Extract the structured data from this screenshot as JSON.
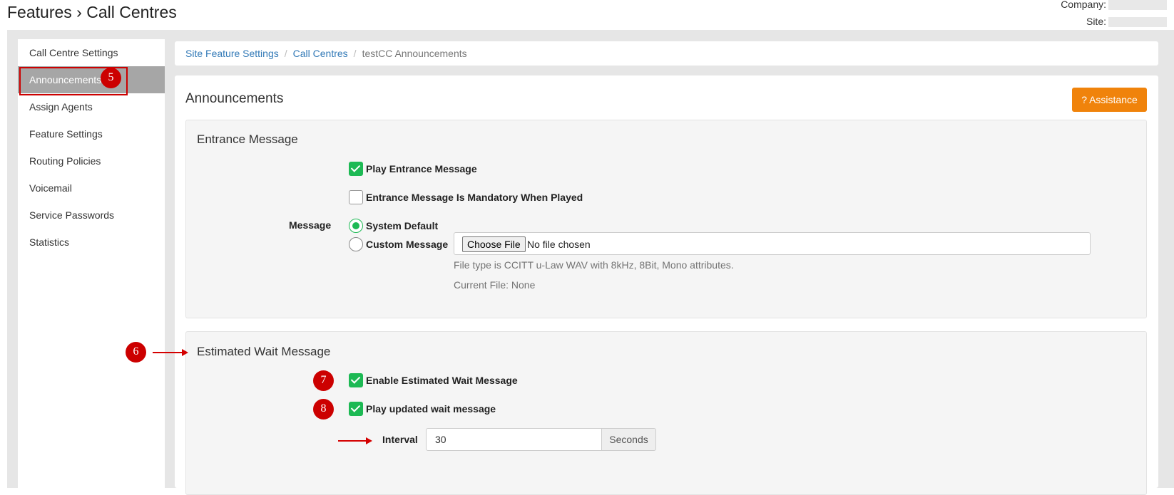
{
  "header": {
    "title": "Features › Call Centres",
    "company_label": "Company:",
    "site_label": "Site:"
  },
  "sidebar": {
    "items": [
      {
        "label": "Call Centre Settings"
      },
      {
        "label": "Announcements"
      },
      {
        "label": "Assign Agents"
      },
      {
        "label": "Feature Settings"
      },
      {
        "label": "Routing Policies"
      },
      {
        "label": "Voicemail"
      },
      {
        "label": "Service Passwords"
      },
      {
        "label": "Statistics"
      }
    ]
  },
  "breadcrumb": {
    "items": [
      "Site Feature Settings",
      "Call Centres"
    ],
    "separator": "/",
    "current": "testCC Announcements"
  },
  "panel": {
    "title": "Announcements",
    "assistance_label": "? Assistance"
  },
  "entrance": {
    "title": "Entrance Message",
    "play_label": "Play Entrance Message",
    "mandatory_label": "Entrance Message Is Mandatory When Played",
    "message_label": "Message",
    "system_default_label": "System Default",
    "custom_label": "Custom Message",
    "choose_file_label": "Choose File",
    "no_file_label": "No file chosen",
    "file_help": "File type is CCITT u-Law WAV with 8kHz, 8Bit, Mono attributes.",
    "current_file": "Current File: None"
  },
  "wait": {
    "title": "Estimated Wait Message",
    "enable_label": "Enable Estimated Wait Message",
    "updated_label": "Play updated wait message",
    "interval_label": "Interval",
    "interval_value": "30",
    "interval_unit": "Seconds"
  },
  "annotations": {
    "badges": [
      "5",
      "6",
      "7",
      "8"
    ],
    "color": "#cc0000"
  },
  "colors": {
    "accent": "#f0830b",
    "check": "#1db954",
    "link": "#337ab7"
  }
}
